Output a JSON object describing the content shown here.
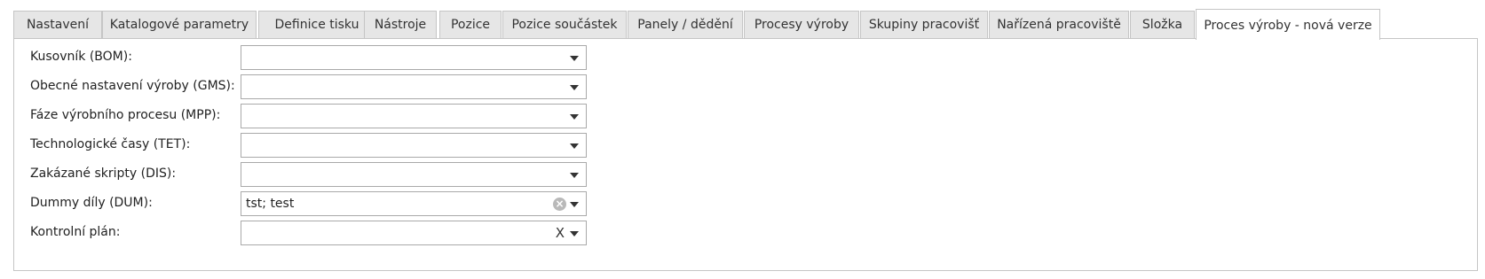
{
  "tabs": [
    {
      "label": "Nastavení"
    },
    {
      "label": "Katalogové parametry"
    },
    {
      "label": "Definice tisku"
    },
    {
      "label": "Nástroje"
    },
    {
      "label": "Pozice"
    },
    {
      "label": "Pozice součástek"
    },
    {
      "label": "Panely / dědění"
    },
    {
      "label": "Procesy výroby"
    },
    {
      "label": "Skupiny pracovišť"
    },
    {
      "label": "Nařízená pracoviště"
    },
    {
      "label": "Složka"
    },
    {
      "label": "Proces výroby - nová verze"
    }
  ],
  "active_tab_index": 11,
  "form": {
    "fields": [
      {
        "label": "Kusovník (BOM):",
        "value": ""
      },
      {
        "label": "Obecné nastavení výroby (GMS):",
        "value": ""
      },
      {
        "label": "Fáze výrobního procesu (MPP):",
        "value": ""
      },
      {
        "label": "Technologické časy (TET):",
        "value": ""
      },
      {
        "label": "Zakázané skripty (DIS):",
        "value": ""
      },
      {
        "label": "Dummy díly (DUM):",
        "value": "tst; test"
      },
      {
        "label": "Kontrolní plán:",
        "value": ""
      }
    ],
    "clear_glyph": "X"
  },
  "icons": {
    "dropdown": "chevron-down-icon",
    "clear_filled": "clear-circle-icon",
    "clear_plain": "clear-x-icon"
  }
}
